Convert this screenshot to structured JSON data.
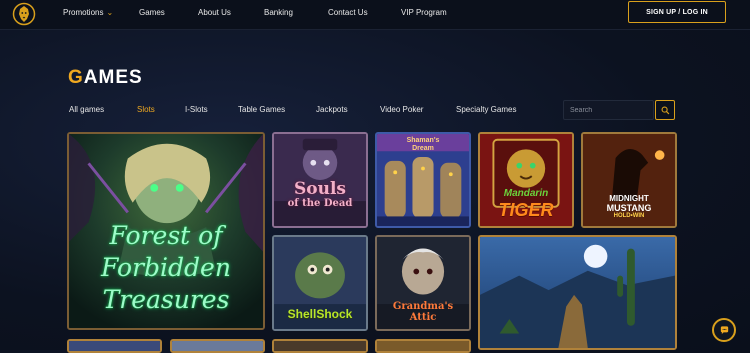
{
  "nav": {
    "items": [
      "Promotions",
      "Games",
      "About Us",
      "Banking",
      "Contact Us",
      "VIP Program"
    ],
    "signup_label": "SIGN UP / LOG IN"
  },
  "page": {
    "heading_first": "G",
    "heading_rest": "AMES"
  },
  "tabs": [
    "All games",
    "Slots",
    "I-Slots",
    "Table Games",
    "Jackpots",
    "Video Poker",
    "Specialty Games"
  ],
  "active_tab": "Slots",
  "search": {
    "placeholder": "Search"
  },
  "games": [
    {
      "title_line1": "Forest of",
      "title_line2": "Forbidden",
      "title_line3": "Treasures"
    },
    {
      "title_line1": "Souls",
      "title_line2": "of the Dead"
    },
    {
      "title_line1": "Shaman's",
      "title_line2": "Dream"
    },
    {
      "title_line1": "Mandarin",
      "title_line2": "TIGER"
    },
    {
      "title_line1": "MIDNIGHT",
      "title_line2": "MUSTANG",
      "title_line3": "HOLD•WIN"
    },
    {
      "title_line1": "Shell",
      "title_line2": "Shock"
    },
    {
      "title_line1": "Grandma's",
      "title_line2": "Attic"
    },
    {
      "title_line1": ""
    }
  ],
  "colors": {
    "accent": "#f0a920",
    "background": "#0d1320",
    "tile_border": "#8a6a3a"
  }
}
